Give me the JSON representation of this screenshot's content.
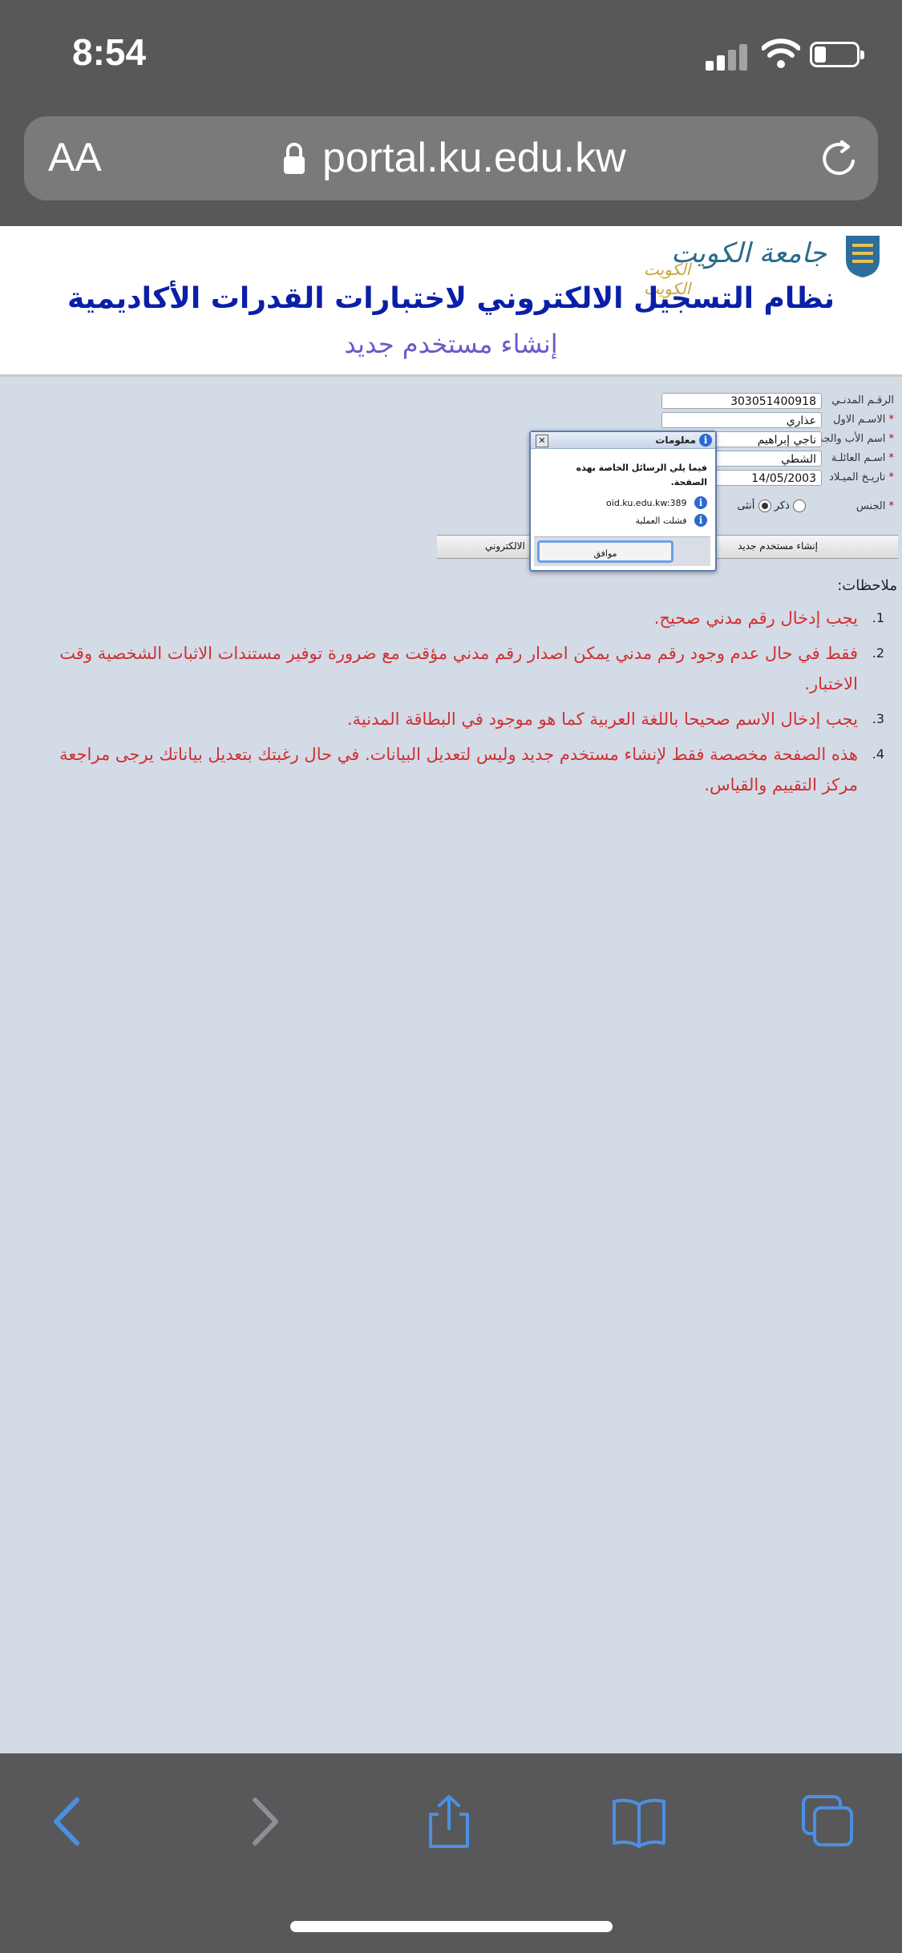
{
  "status_bar": {
    "time": "8:54"
  },
  "browser": {
    "aa_label": "AA",
    "url": "portal.ku.edu.kw"
  },
  "header": {
    "logo_text": "جامعة الكويت",
    "logo_subtext": "الكويت الكويت",
    "title": "نظام التسجيل الالكتروني لاختبارات القدرات الأكاديمية",
    "subtitle": "إنشاء مستخدم جديد"
  },
  "form": {
    "civil_id": {
      "label": "الرقـم المدنـي",
      "value": "303051400918"
    },
    "first_name": {
      "label": "الاسـم الاول",
      "value": "عذاري"
    },
    "father_name": {
      "label": "اسم الأب والجد",
      "value": "ناجي إبراهيم"
    },
    "family_name": {
      "label": "اسـم العائلـة",
      "value": "الشطي"
    },
    "birth_date": {
      "label": "تاريـخ الميـلاد",
      "value": "14/05/2003"
    },
    "gender": {
      "label": "الجنس",
      "male": "ذكر",
      "female": "أنثى",
      "selected": "female"
    },
    "required_mark": "*"
  },
  "buttons": {
    "create_user": "إنشاء مستخدم جديد",
    "email": "الالكتروني"
  },
  "dialog": {
    "title": "معلومات",
    "close": "✕",
    "message": "فيما يلي الرسائل الخاصة بهذه الصفحة.",
    "line1": "oid.ku.edu.kw:389",
    "line2": "فشلت العملية",
    "ok": "موافق"
  },
  "notes": {
    "title": "ملاحظات:",
    "items": [
      {
        "num": "1.",
        "text": "يجب إدخال رقم مدني صحيح."
      },
      {
        "num": "2.",
        "text": "فقط في حال عدم وجود رقم مدني يمكن اصدار رقم مدني مؤقت مع ضرورة توفير مستندات الاثبات الشخصية وقت الاختبار."
      },
      {
        "num": "3.",
        "text": "يجب إدخال الاسم صحيحا باللغة العربية كما هو موجود في البطاقة المدنية."
      },
      {
        "num": "4.",
        "text": "هذه الصفحة مخصصة فقط لإنشاء مستخدم جديد وليس لتعديل البيانات. في حال رغبتك بتعديل بياناتك يرجى مراجعة مركز التقييم والقياس."
      }
    ]
  },
  "colors": {
    "page_bg": "#d3dbe7",
    "title": "#0a1fa8",
    "subtitle": "#6a5bc9",
    "note_text": "#d13030",
    "chrome": "#58585a"
  }
}
